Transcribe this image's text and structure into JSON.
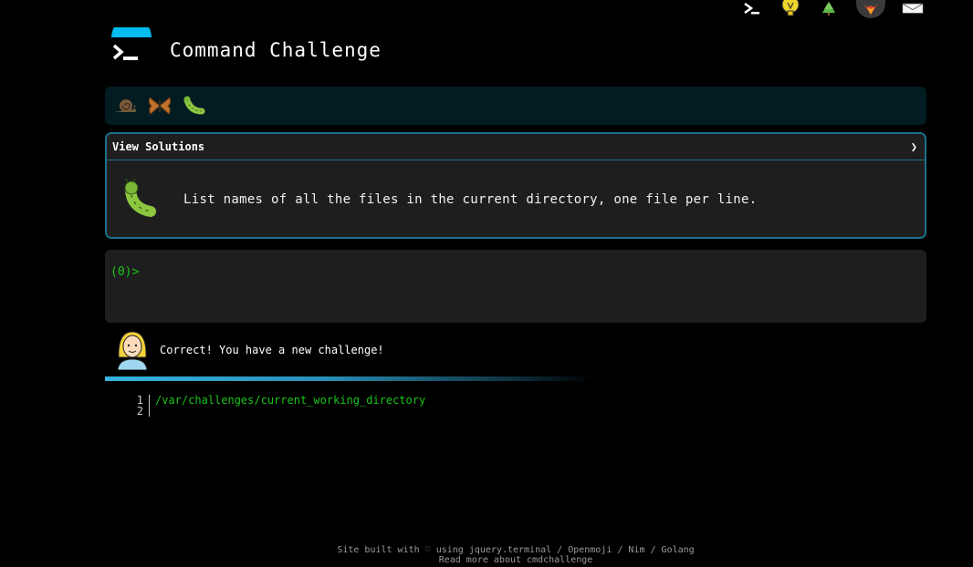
{
  "top_icons": [
    {
      "name": "terminal-icon"
    },
    {
      "name": "lightbulb-icon"
    },
    {
      "name": "tree-icon"
    },
    {
      "name": "gitlab-fox-icon"
    },
    {
      "name": "envelope-icon"
    }
  ],
  "header": {
    "title": "Command Challenge"
  },
  "badges": [
    {
      "name": "snail-badge-icon"
    },
    {
      "name": "butterfly-badge-icon"
    },
    {
      "name": "caterpillar-badge-icon"
    }
  ],
  "challenge": {
    "solutions_label": "View Solutions",
    "chevron": "❯",
    "description": "List names of all the files in the current directory, one file per line."
  },
  "terminal": {
    "prompt": "(0)>"
  },
  "feedback": {
    "message": "Correct! You have a new challenge!"
  },
  "progress": {
    "fraction": 0.5
  },
  "editor": {
    "line_numbers": [
      "1",
      "2"
    ],
    "lines": [
      "/var/challenges/current_working_directory",
      ""
    ]
  },
  "footer": {
    "line1": "Site built with ♡ using jquery.terminal / Openmoji / Nim / Golang",
    "line2": "Read more about cmdchallenge"
  },
  "colors": {
    "accent": "#1d6f8a",
    "terminal_green": "#19c519",
    "badge_bar_bg": "#021c22",
    "panel_bg": "#1e1e1e"
  }
}
